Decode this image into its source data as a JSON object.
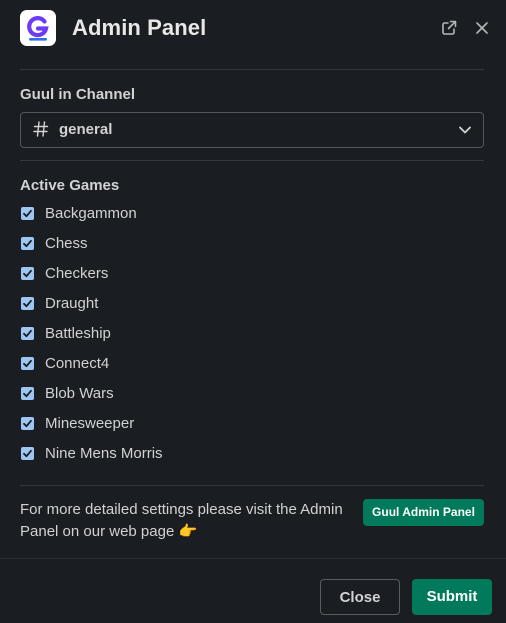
{
  "header": {
    "title": "Admin Panel",
    "logo_letter": "G",
    "open_external_icon": "open-in-new-window-icon",
    "close_icon": "close-icon"
  },
  "channel": {
    "label": "Guul in Channel",
    "icon": "hash-icon",
    "value": "general"
  },
  "games": {
    "label": "Active Games",
    "items": [
      {
        "label": "Backgammon",
        "checked": true
      },
      {
        "label": "Chess",
        "checked": true
      },
      {
        "label": "Checkers",
        "checked": true
      },
      {
        "label": "Draught",
        "checked": true
      },
      {
        "label": "Battleship",
        "checked": true
      },
      {
        "label": "Connect4",
        "checked": true
      },
      {
        "label": "Blob Wars",
        "checked": true
      },
      {
        "label": "Minesweeper",
        "checked": true
      },
      {
        "label": "Nine Mens Morris",
        "checked": true
      }
    ]
  },
  "info": {
    "text": "For more detailed settings please visit the Admin Panel on our web page",
    "emoji": "👉",
    "link_label": "Guul Admin Panel"
  },
  "footer": {
    "close_label": "Close",
    "submit_label": "Submit"
  },
  "colors": {
    "background": "#1a1d21",
    "accent_green": "#007a5a",
    "checkbox": "#9ec6f3",
    "logo_purple": "#6c3bf5"
  }
}
